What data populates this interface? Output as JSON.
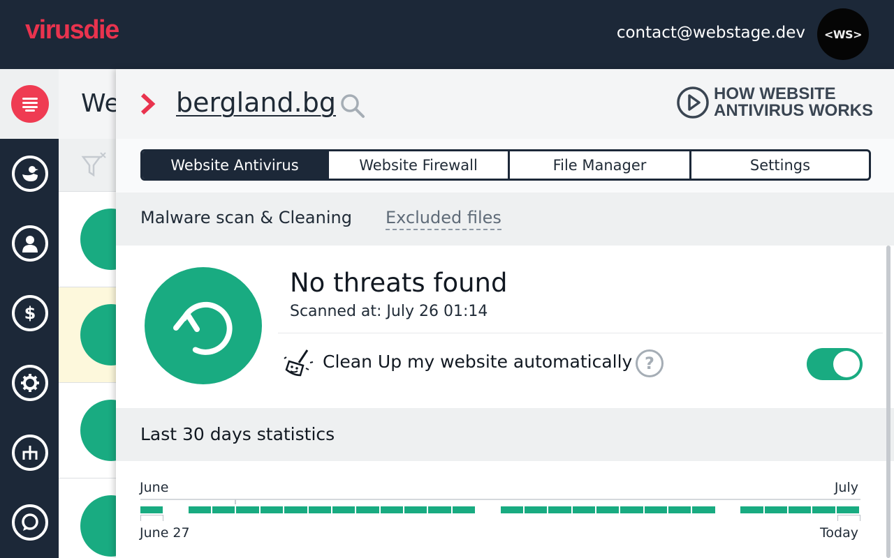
{
  "header": {
    "logo": "virusdie",
    "user_email": "contact@webstage.dev",
    "avatar_text": "<WS>"
  },
  "background_list": {
    "title_partial": "We"
  },
  "panel": {
    "site_name": "bergland.bg",
    "how_button": "HOW WEBSITE ANTIVIRUS WORKS",
    "tabs": [
      {
        "label": "Website Antivirus",
        "active": true
      },
      {
        "label": "Website Firewall",
        "active": false
      },
      {
        "label": "File Manager",
        "active": false
      },
      {
        "label": "Settings",
        "active": false
      }
    ],
    "subtabs": {
      "active": "Malware scan & Cleaning",
      "link": "Excluded files"
    },
    "status": {
      "title": "No threats found",
      "scanned_at": "Scanned at: July 26 01:14",
      "cleanup_label": "Clean Up my website automatically",
      "help": "?",
      "auto_cleanup_enabled": true
    },
    "stats": {
      "title": "Last 30 days statistics",
      "month_start": "June",
      "month_end": "July",
      "first_day": "June 27",
      "last_day": "Today",
      "days_scanned": [
        true,
        false,
        true,
        true,
        true,
        true,
        true,
        true,
        true,
        true,
        true,
        true,
        true,
        true,
        false,
        true,
        true,
        true,
        true,
        true,
        true,
        true,
        true,
        true,
        false,
        true,
        true,
        true,
        true,
        true
      ]
    }
  },
  "colors": {
    "navy": "#1c2838",
    "brand_red": "#e9334e",
    "accent_green": "#19ab81"
  },
  "icons": {
    "menu": "menu-icon",
    "nav": [
      "duck-icon",
      "user-icon",
      "dollar-icon",
      "gear-icon",
      "sitemap-icon",
      "chat-icon"
    ],
    "search": "search-icon",
    "play": "play-circle-icon",
    "status": "refresh-icon",
    "broom": "broom-icon"
  }
}
